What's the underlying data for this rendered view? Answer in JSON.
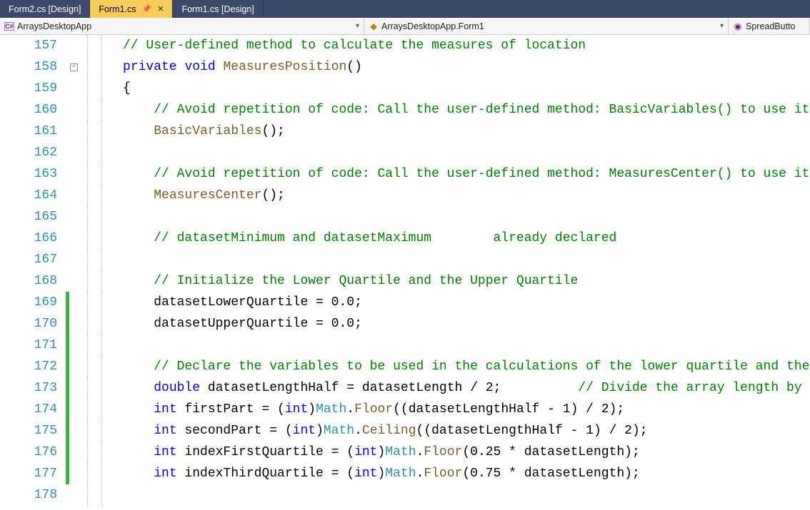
{
  "tabs": [
    {
      "label": "Form2.cs [Design]",
      "active": false
    },
    {
      "label": "Form1.cs",
      "active": true,
      "pinned": true
    },
    {
      "label": "Form1.cs [Design]",
      "active": false
    }
  ],
  "nav": {
    "left": "ArraysDesktopApp",
    "mid": "ArraysDesktopApp.Form1",
    "right": "SpreadButto"
  },
  "lines": [
    {
      "n": 157,
      "change": "",
      "collapse": "",
      "tokens": [
        {
          "c": "cm",
          "t": "// User-defined method to calculate the measures of location"
        }
      ]
    },
    {
      "n": 158,
      "change": "",
      "collapse": "-",
      "tokens": [
        {
          "c": "kw",
          "t": "private"
        },
        {
          "c": "",
          "t": " "
        },
        {
          "c": "kw",
          "t": "void"
        },
        {
          "c": "",
          "t": " "
        },
        {
          "c": "mn",
          "t": "MeasuresPosition"
        },
        {
          "c": "",
          "t": "()"
        }
      ]
    },
    {
      "n": 159,
      "change": "",
      "collapse": "",
      "tokens": [
        {
          "c": "",
          "t": "{"
        }
      ]
    },
    {
      "n": 160,
      "change": "",
      "collapse": "",
      "indent": 1,
      "tokens": [
        {
          "c": "cm",
          "t": "// Avoid repetition of code: Call the user-defined method: BasicVariables() to use its resources"
        }
      ]
    },
    {
      "n": 161,
      "change": "",
      "collapse": "",
      "indent": 1,
      "tokens": [
        {
          "c": "mn",
          "t": "BasicVariables"
        },
        {
          "c": "",
          "t": "();"
        }
      ]
    },
    {
      "n": 162,
      "change": "",
      "collapse": "",
      "indent": 1,
      "tokens": []
    },
    {
      "n": 163,
      "change": "",
      "collapse": "",
      "indent": 1,
      "tokens": [
        {
          "c": "cm",
          "t": "// Avoid repetition of code: Call the user-defined method: MeasuresCenter() to use its resources"
        }
      ]
    },
    {
      "n": 164,
      "change": "",
      "collapse": "",
      "indent": 1,
      "tokens": [
        {
          "c": "mn",
          "t": "MeasuresCenter"
        },
        {
          "c": "",
          "t": "();"
        }
      ]
    },
    {
      "n": 165,
      "change": "",
      "collapse": "",
      "indent": 1,
      "tokens": []
    },
    {
      "n": 166,
      "change": "",
      "collapse": "",
      "indent": 1,
      "tokens": [
        {
          "c": "cm",
          "t": "// datasetMinimum and datasetMaximum        already declared"
        }
      ]
    },
    {
      "n": 167,
      "change": "",
      "collapse": "",
      "indent": 1,
      "tokens": []
    },
    {
      "n": 168,
      "change": "",
      "collapse": "",
      "indent": 1,
      "tokens": [
        {
          "c": "cm",
          "t": "// Initialize the Lower Quartile and the Upper Quartile"
        }
      ]
    },
    {
      "n": 169,
      "change": "green",
      "collapse": "",
      "indent": 1,
      "tokens": [
        {
          "c": "id",
          "t": "datasetLowerQuartile = 0.0;"
        }
      ]
    },
    {
      "n": 170,
      "change": "green",
      "collapse": "",
      "indent": 1,
      "tokens": [
        {
          "c": "id",
          "t": "datasetUpperQuartile = 0.0;"
        }
      ]
    },
    {
      "n": 171,
      "change": "green",
      "collapse": "",
      "indent": 1,
      "tokens": []
    },
    {
      "n": 172,
      "change": "green",
      "collapse": "",
      "indent": 1,
      "tokens": [
        {
          "c": "cm",
          "t": "// Declare the variables to be used in the calculations of the lower quartile and the upper quartile"
        }
      ]
    },
    {
      "n": 173,
      "change": "green",
      "collapse": "",
      "indent": 1,
      "tokens": [
        {
          "c": "kw",
          "t": "double"
        },
        {
          "c": "",
          "t": " datasetLengthHalf = datasetLength / 2;          "
        },
        {
          "c": "cm",
          "t": "// Divide the array length by two"
        }
      ]
    },
    {
      "n": 174,
      "change": "green",
      "collapse": "",
      "indent": 1,
      "tokens": [
        {
          "c": "kw",
          "t": "int"
        },
        {
          "c": "",
          "t": " firstPart = ("
        },
        {
          "c": "kw",
          "t": "int"
        },
        {
          "c": "",
          "t": ")"
        },
        {
          "c": "ty",
          "t": "Math"
        },
        {
          "c": "",
          "t": "."
        },
        {
          "c": "mn",
          "t": "Floor"
        },
        {
          "c": "",
          "t": "((datasetLengthHalf - 1) / 2);"
        }
      ]
    },
    {
      "n": 175,
      "change": "green",
      "collapse": "",
      "indent": 1,
      "tokens": [
        {
          "c": "kw",
          "t": "int"
        },
        {
          "c": "",
          "t": " secondPart = ("
        },
        {
          "c": "kw",
          "t": "int"
        },
        {
          "c": "",
          "t": ")"
        },
        {
          "c": "ty",
          "t": "Math"
        },
        {
          "c": "",
          "t": "."
        },
        {
          "c": "mn",
          "t": "Ceiling"
        },
        {
          "c": "",
          "t": "((datasetLengthHalf - 1) / 2);"
        }
      ]
    },
    {
      "n": 176,
      "change": "green",
      "collapse": "",
      "indent": 1,
      "tokens": [
        {
          "c": "kw",
          "t": "int"
        },
        {
          "c": "",
          "t": " indexFirstQuartile = ("
        },
        {
          "c": "kw",
          "t": "int"
        },
        {
          "c": "",
          "t": ")"
        },
        {
          "c": "ty",
          "t": "Math"
        },
        {
          "c": "",
          "t": "."
        },
        {
          "c": "mn",
          "t": "Floor"
        },
        {
          "c": "",
          "t": "(0.25 * datasetLength);"
        }
      ]
    },
    {
      "n": 177,
      "change": "green",
      "collapse": "",
      "indent": 1,
      "tokens": [
        {
          "c": "kw",
          "t": "int"
        },
        {
          "c": "",
          "t": " indexThirdQuartile = ("
        },
        {
          "c": "kw",
          "t": "int"
        },
        {
          "c": "",
          "t": ")"
        },
        {
          "c": "ty",
          "t": "Math"
        },
        {
          "c": "",
          "t": "."
        },
        {
          "c": "mn",
          "t": "Floor"
        },
        {
          "c": "",
          "t": "(0.75 * datasetLength);"
        }
      ]
    },
    {
      "n": 178,
      "change": "",
      "collapse": "",
      "indent": 1,
      "tokens": []
    }
  ]
}
